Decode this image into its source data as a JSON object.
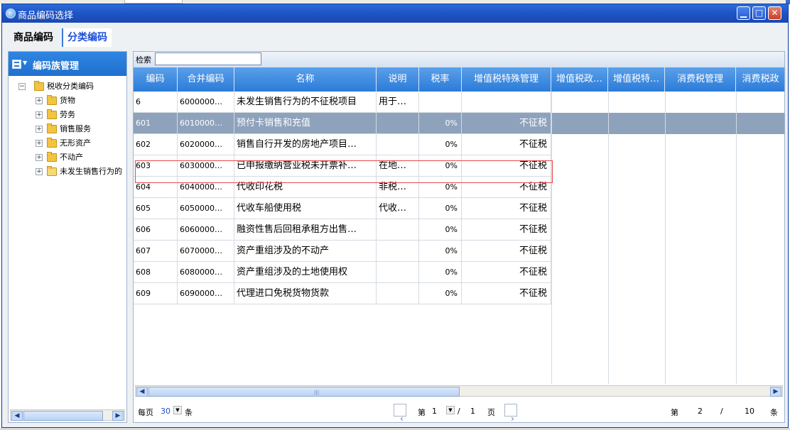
{
  "window": {
    "title": "商品编码选择"
  },
  "tabs": [
    {
      "label": "商品编码"
    },
    {
      "label": "分类编码"
    }
  ],
  "left_panel": {
    "header": "编码族管理",
    "tree": {
      "root": "税收分类编码",
      "children": [
        "货物",
        "劳务",
        "销售服务",
        "无形资产",
        "不动产",
        "未发生销售行为的"
      ]
    }
  },
  "search": {
    "label": "检索",
    "value": ""
  },
  "grid": {
    "columns": [
      "编码",
      "合并编码",
      "名称",
      "说明",
      "税率",
      "增值税特殊管理",
      "增值税政…",
      "增值税特…",
      "消费税管理",
      "消费税政"
    ],
    "rows": [
      {
        "code": "6",
        "merged": "6000000…",
        "name": "未发生销售行为的不征税项目",
        "note": "用于…",
        "rate": "",
        "vat": ""
      },
      {
        "code": "601",
        "merged": "6010000…",
        "name": "预付卡销售和充值",
        "note": "",
        "rate": "0%",
        "vat": "不征税"
      },
      {
        "code": "602",
        "merged": "6020000…",
        "name": "销售自行开发的房地产项目…",
        "note": "",
        "rate": "0%",
        "vat": "不征税"
      },
      {
        "code": "603",
        "merged": "6030000…",
        "name": "已申报缴纳营业税未开票补…",
        "note": "在地…",
        "rate": "0%",
        "vat": "不征税"
      },
      {
        "code": "604",
        "merged": "6040000…",
        "name": "代收印花税",
        "note": "非税…",
        "rate": "0%",
        "vat": "不征税"
      },
      {
        "code": "605",
        "merged": "6050000…",
        "name": "代收车船使用税",
        "note": "代收…",
        "rate": "0%",
        "vat": "不征税"
      },
      {
        "code": "606",
        "merged": "6060000…",
        "name": "融资性售后回租承租方出售…",
        "note": "",
        "rate": "0%",
        "vat": "不征税"
      },
      {
        "code": "607",
        "merged": "6070000…",
        "name": "资产重组涉及的不动产",
        "note": "",
        "rate": "0%",
        "vat": "不征税"
      },
      {
        "code": "608",
        "merged": "6080000…",
        "name": "资产重组涉及的土地使用权",
        "note": "",
        "rate": "0%",
        "vat": "不征税"
      },
      {
        "code": "609",
        "merged": "6090000…",
        "name": "代理进口免税货物货款",
        "note": "",
        "rate": "0%",
        "vat": "不征税"
      }
    ]
  },
  "pager": {
    "per_page_label": "每页",
    "per_page_value": "30",
    "unit": "条",
    "page_prefix": "第",
    "current_page": "1",
    "slash": "/",
    "total_pages": "1",
    "page_suffix": "页",
    "record_prefix": "第",
    "record_current": "2",
    "record_slash": "/",
    "record_total": "10",
    "record_unit": "条"
  }
}
